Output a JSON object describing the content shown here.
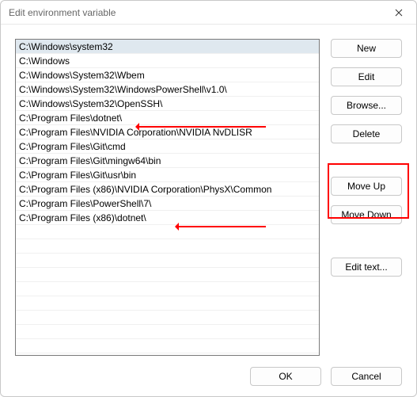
{
  "title": "Edit environment variable",
  "list_items": [
    "C:\\Windows\\system32",
    "C:\\Windows",
    "C:\\Windows\\System32\\Wbem",
    "C:\\Windows\\System32\\WindowsPowerShell\\v1.0\\",
    "C:\\Windows\\System32\\OpenSSH\\",
    "C:\\Program Files\\dotnet\\",
    "C:\\Program Files\\NVIDIA Corporation\\NVIDIA NvDLISR",
    "C:\\Program Files\\Git\\cmd",
    "C:\\Program Files\\Git\\mingw64\\bin",
    "C:\\Program Files\\Git\\usr\\bin",
    "C:\\Program Files (x86)\\NVIDIA Corporation\\PhysX\\Common",
    "C:\\Program Files\\PowerShell\\7\\",
    "C:\\Program Files (x86)\\dotnet\\"
  ],
  "selected_index": 0,
  "buttons": {
    "new": "New",
    "edit": "Edit",
    "browse": "Browse...",
    "delete": "Delete",
    "move_up": "Move Up",
    "move_down": "Move Down",
    "edit_text": "Edit text...",
    "ok": "OK",
    "cancel": "Cancel"
  },
  "annotations": {
    "color": "#ff0000",
    "arrows_to_rows": [
      5,
      12
    ],
    "highlight_buttons": [
      "move_up",
      "move_down"
    ]
  }
}
